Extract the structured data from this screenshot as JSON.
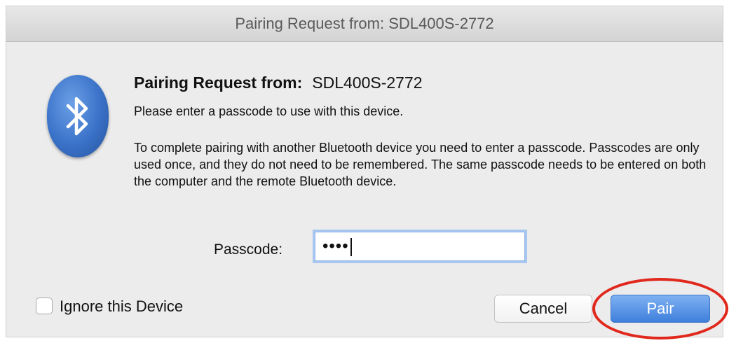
{
  "window": {
    "title": "Pairing Request from: SDL400S-2772"
  },
  "dialog": {
    "heading_label": "Pairing Request from:",
    "device_name": "SDL400S-2772",
    "subtext": "Please enter a passcode to use with this device.",
    "body_text": "To complete pairing with another Bluetooth device you need to enter a passcode. Passcodes are only used once, and they do not need to be remembered. The same passcode needs to be entered on both the computer and the remote Bluetooth device."
  },
  "passcode": {
    "label": "Passcode:",
    "masked_value": "••••"
  },
  "ignore_device": {
    "label": "Ignore this Device",
    "checked": false
  },
  "buttons": {
    "cancel_label": "Cancel",
    "pair_label": "Pair"
  },
  "icons": {
    "app_icon": "bluetooth-icon"
  },
  "colors": {
    "accent": "#3f7fdc",
    "highlight_ring": "#e0281c",
    "icon_blue": "#3a72c8"
  }
}
